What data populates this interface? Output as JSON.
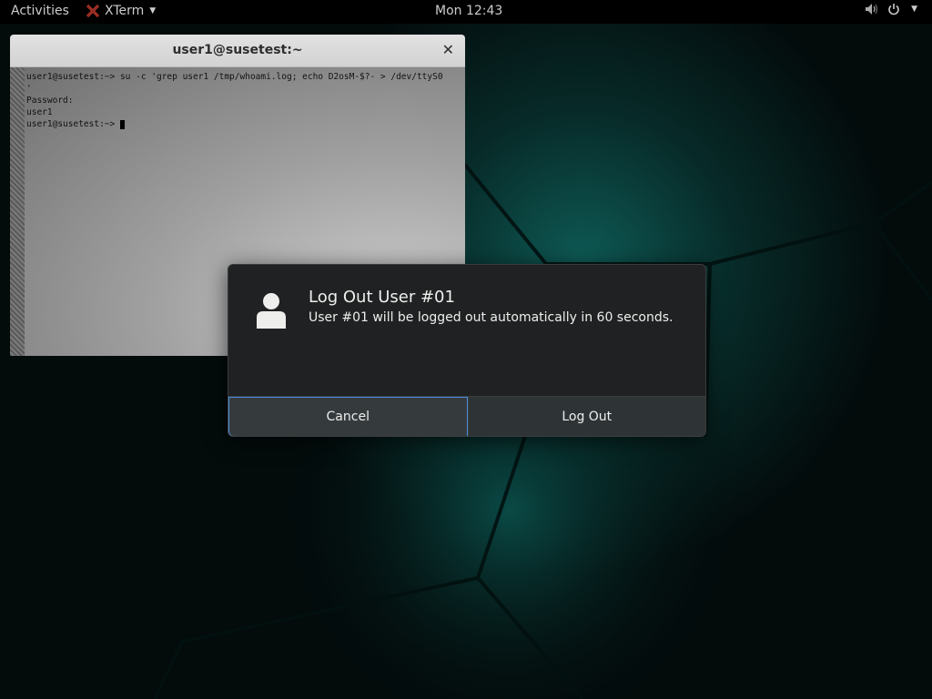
{
  "topbar": {
    "activities": "Activities",
    "app_name": "XTerm",
    "clock": "Mon 12:43",
    "icons": [
      "volume-icon",
      "power-icon",
      "chevron-down-icon"
    ]
  },
  "xterm": {
    "title": "user1@susetest:~",
    "lines": [
      "user1@susetest:~> su -c 'grep user1 /tmp/whoami.log; echo D2osM-$?- > /dev/ttyS0",
      "'",
      "Password:",
      "user1",
      "user1@susetest:~> "
    ]
  },
  "modal": {
    "title": "Log Out User #01",
    "description": "User #01 will be logged out automatically in 60 seconds.",
    "cancel_label": "Cancel",
    "logout_label": "Log Out"
  },
  "colors": {
    "topbar_bg": "#000000",
    "modal_bg": "#1f2122",
    "button_bg": "#2e3436",
    "focus_border": "#4a90d9",
    "wallpaper_accent": "#0e5a55"
  }
}
